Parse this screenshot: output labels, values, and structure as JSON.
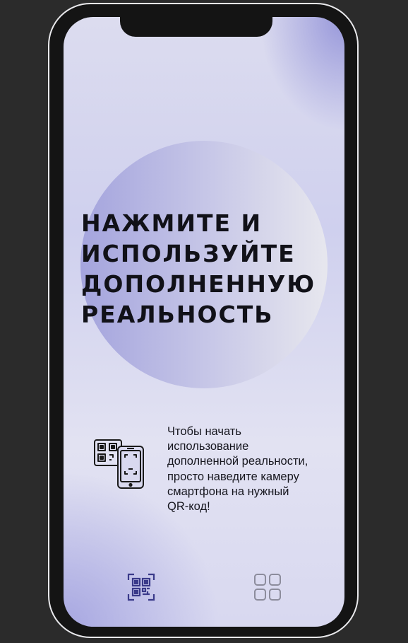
{
  "headline": {
    "line1": "НАЖМИТЕ И",
    "line2": "ИСПОЛЬЗУЙТЕ",
    "line3": "ДОПОЛНЕННУЮ",
    "line4": "РЕАЛЬНОСТЬ"
  },
  "instructions": {
    "line1": "Чтобы начать",
    "line2": "использование",
    "line3": "дополненной реальности,",
    "line4": "просто наведите камеру",
    "line5": "смартфона на нужный",
    "line6": "QR-код!",
    "icon": "qr-phone-scan-icon"
  },
  "bottom_nav": {
    "items": [
      {
        "icon": "qr-scan-icon",
        "active": true
      },
      {
        "icon": "grid-menu-icon",
        "active": false
      }
    ]
  },
  "colors": {
    "frame": "#141414",
    "frame_outline": "#e9e9ec",
    "screen_top": "#dcdcef",
    "accent_purple": "#8a8ad6",
    "circle_left": "#a4a4dd",
    "circle_right": "#e7e7ee",
    "text": "#111118",
    "qr_icon_color": "#3a3a8a",
    "grid_icon_color": "#8c8c9c"
  }
}
